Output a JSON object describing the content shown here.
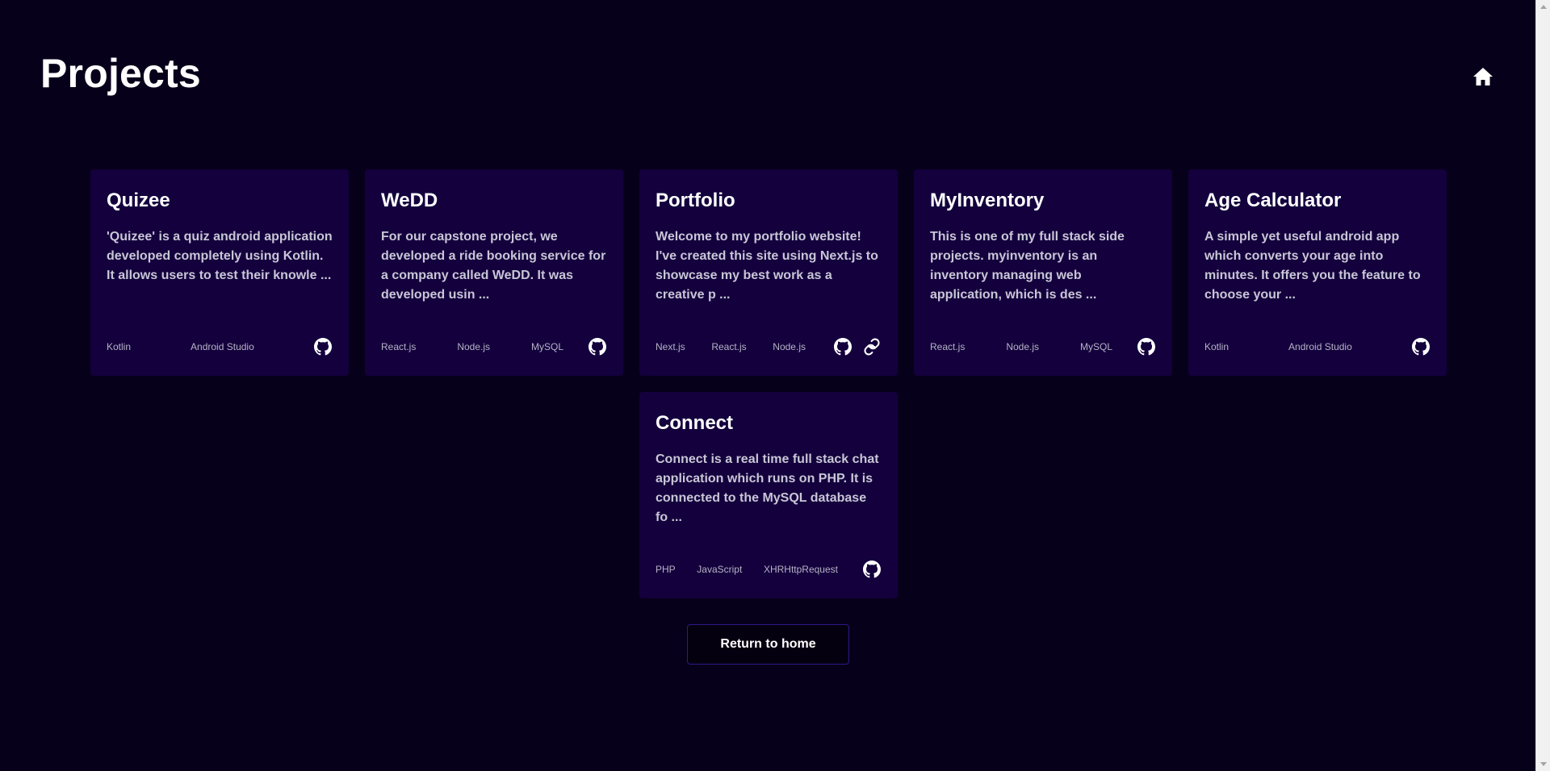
{
  "page": {
    "title": "Projects",
    "home_icon": "home-icon",
    "return_label": "Return to home"
  },
  "colors": {
    "background": "#07001a",
    "card": "#13003d",
    "button_border": "#2b1a8a"
  },
  "projects": [
    {
      "title": "Quizee",
      "description": "'Quizee' is a quiz android application developed completely using Kotlin. It allows users to test their knowle ...",
      "tags": [
        "Kotlin",
        "Android Studio"
      ],
      "icons": [
        "github-icon"
      ]
    },
    {
      "title": "WeDD",
      "description": "For our capstone project, we developed a ride booking service for a company called WeDD. It was developed usin ...",
      "tags": [
        "React.js",
        "Node.js",
        "MySQL"
      ],
      "icons": [
        "github-icon"
      ]
    },
    {
      "title": "Portfolio",
      "description": "Welcome to my portfolio website! I've created this site using Next.js to showcase my best work as a creative p ...",
      "tags": [
        "Next.js",
        "React.js",
        "Node.js"
      ],
      "icons": [
        "github-icon",
        "link-icon"
      ]
    },
    {
      "title": "MyInventory",
      "description": "This is one of my full stack side projects. myinventory is an inventory managing web application, which is des ...",
      "tags": [
        "React.js",
        "Node.js",
        "MySQL"
      ],
      "icons": [
        "github-icon"
      ]
    },
    {
      "title": "Age Calculator",
      "description": "A simple yet useful android app which converts your age into minutes. It offers you the feature to choose your ...",
      "tags": [
        "Kotlin",
        "Android Studio"
      ],
      "icons": [
        "github-icon"
      ]
    },
    {
      "title": "Connect",
      "description": "Connect is a real time full stack chat application which runs on PHP. It is connected to the MySQL database fo ...",
      "tags": [
        "PHP",
        "JavaScript",
        "XHRHttpRequest"
      ],
      "icons": [
        "github-icon"
      ]
    }
  ]
}
